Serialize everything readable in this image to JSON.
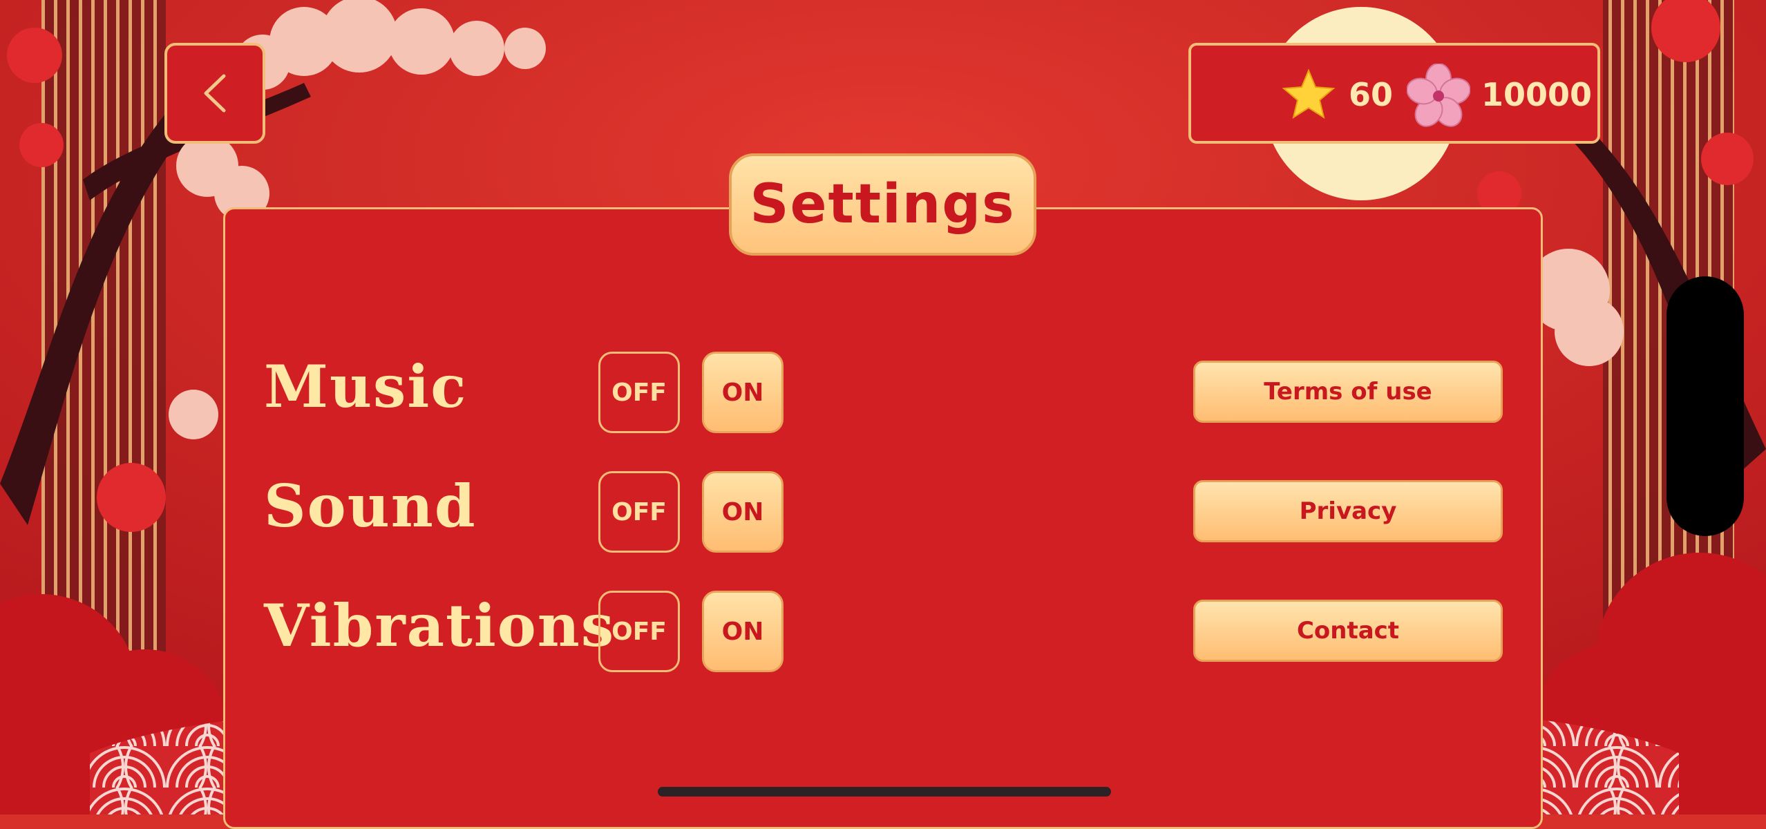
{
  "screen": {
    "title": "Settings"
  },
  "header": {
    "back_icon": "chevron-left-icon",
    "stars": "60",
    "star_icon": "star-icon",
    "flowers": "10000",
    "flower_icon": "sakura-flower-icon"
  },
  "settings": [
    {
      "label": "Music",
      "off_label": "OFF",
      "on_label": "ON",
      "state": "ON"
    },
    {
      "label": "Sound",
      "off_label": "OFF",
      "on_label": "ON",
      "state": "ON"
    },
    {
      "label": "Vibrations",
      "off_label": "OFF",
      "on_label": "ON",
      "state": "ON"
    }
  ],
  "links": {
    "terms": "Terms of use",
    "privacy": "Privacy",
    "contact": "Contact"
  },
  "colors": {
    "primary_red": "#d21f23",
    "gold_border": "#f2bd77",
    "cream": "#ffe2a8",
    "label_text": "#ffe7a5"
  }
}
